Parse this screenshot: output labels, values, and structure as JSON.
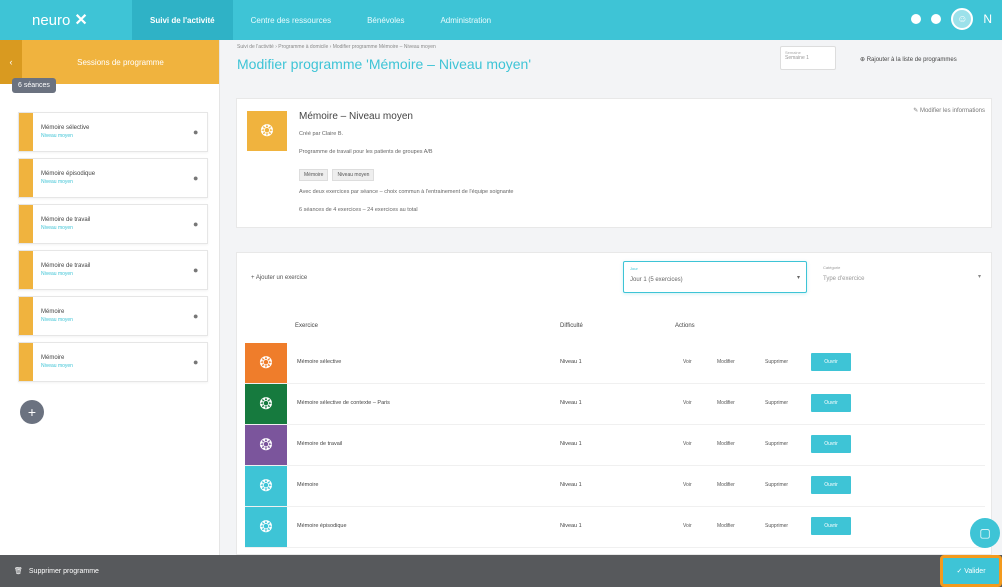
{
  "app": {
    "logo_text": "neuro",
    "top_tabs": [
      {
        "label": "Suivi de l'activité",
        "active": true
      },
      {
        "label": "Centre des ressources",
        "active": false
      },
      {
        "label": "Bénévoles",
        "active": false
      },
      {
        "label": "Administration",
        "active": false
      }
    ]
  },
  "sidebar": {
    "header_label": "Sessions de programme",
    "session_badge": "6 séances",
    "sessions": [
      {
        "name": "Mémoire sélective",
        "sub": "Niveau moyen"
      },
      {
        "name": "Mémoire épisodique",
        "sub": "Niveau moyen"
      },
      {
        "name": "Mémoire de travail",
        "sub": "Niveau moyen"
      },
      {
        "name": "Mémoire de travail",
        "sub": "Niveau moyen"
      },
      {
        "name": "Mémoire",
        "sub": "Niveau moyen"
      },
      {
        "name": "Mémoire",
        "sub": "Niveau moyen"
      }
    ]
  },
  "header": {
    "breadcrumb": "Suivi de l'activité  ›  Programme à domicile  ›  Modifier programme Mémoire – Niveau moyen",
    "title": "Modifier programme 'Mémoire – Niveau moyen'",
    "week_select": {
      "label": "Semaine",
      "value": "Semaine 1"
    },
    "add_to_programs_label": "Rajouter à la liste de programmes"
  },
  "program": {
    "name": "Mémoire – Niveau moyen",
    "meta_lines": [
      "Créé par Claire B.",
      "Programme de travail pour les patients de groupes A/B",
      "Avec deux exercices par séance – choix commun à l'entrainement de l'équipe soignante",
      "6 séances de 4 exercices – 24 exercices au total"
    ],
    "tags": [
      "Mémoire",
      "Niveau moyen"
    ],
    "modify_label": "Modifier les informations"
  },
  "exercises": {
    "add_label": "+ Ajouter un exercice",
    "day_select": {
      "label": "Jour",
      "value": "Jour 1 (5 exercices)"
    },
    "type_select": {
      "label": "Catégorie",
      "value": "Type d'exercice"
    },
    "columns": {
      "exercise": "Exercice",
      "difficulty": "Difficulté",
      "actions": "Actions"
    },
    "rows": [
      {
        "name": "Mémoire sélective",
        "level": "Niveau 1",
        "color": "#ef7d2b"
      },
      {
        "name": "Mémoire sélective de contexte – Paris",
        "level": "Niveau 1",
        "color": "#167a3e"
      },
      {
        "name": "Mémoire de travail",
        "level": "Niveau 1",
        "color": "#7b559c"
      },
      {
        "name": "Mémoire",
        "level": "Niveau 1",
        "color": "#3ec4d6"
      },
      {
        "name": "Mémoire épisodique",
        "level": "Niveau 1",
        "color": "#3ec4d6"
      }
    ],
    "actions": {
      "view": "Voir",
      "edit": "Modifier",
      "remove": "Supprimer",
      "open": "Ouvrir"
    }
  },
  "footer": {
    "delete_label": "Supprimer programme",
    "save_label": "Valider"
  },
  "colors": {
    "accent": "#3ec4d6",
    "sidebar_orange": "#f0b33e",
    "bottom_bar": "#57595c",
    "save_outline": "#f39a1d"
  },
  "icons": [
    "logo-icon",
    "bell-icon",
    "help-icon",
    "avatar-icon",
    "back-arrow-icon",
    "brain-icon",
    "chat-icon",
    "trash-icon",
    "check-icon"
  ]
}
